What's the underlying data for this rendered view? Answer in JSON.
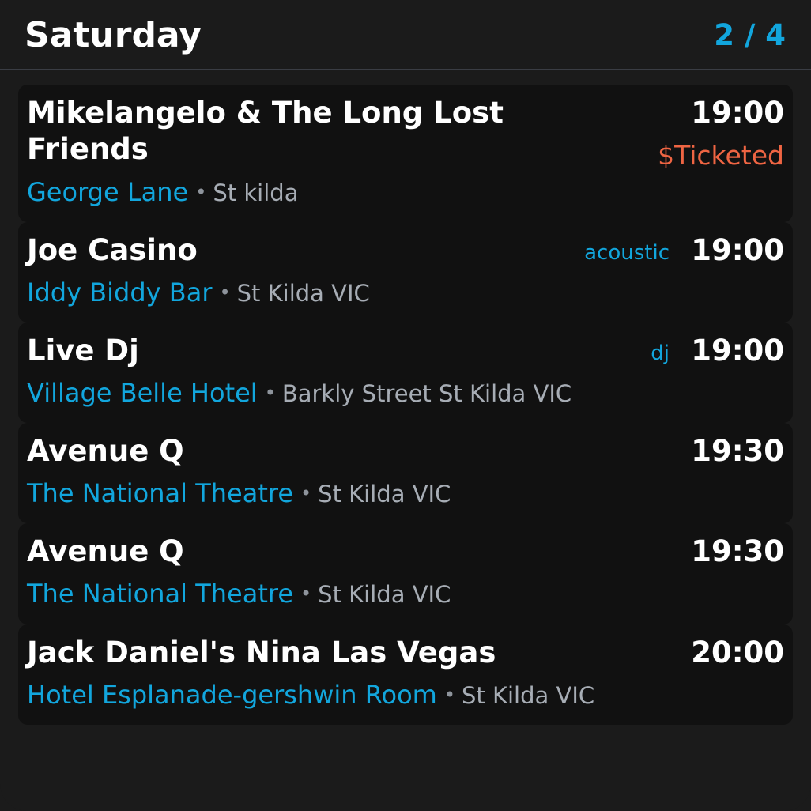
{
  "header": {
    "title": "Saturday",
    "page_counter": "2 / 4"
  },
  "events": [
    {
      "title": "Mikelangelo & The Long Lost Friends",
      "time": "19:00",
      "price": "$Ticketed",
      "genre": "",
      "venue": "George Lane",
      "separator": "•",
      "area": "St kilda"
    },
    {
      "title": "Joe Casino",
      "time": "19:00",
      "price": "",
      "genre": "acoustic",
      "venue": "Iddy Biddy Bar",
      "separator": "•",
      "area": "St Kilda VIC"
    },
    {
      "title": "Live Dj",
      "time": "19:00",
      "price": "",
      "genre": "dj",
      "venue": "Village Belle Hotel",
      "separator": "•",
      "area": "Barkly Street St Kilda VIC"
    },
    {
      "title": "Avenue Q",
      "time": "19:30",
      "price": "",
      "genre": "",
      "venue": "The National Theatre",
      "separator": "•",
      "area": "St Kilda VIC"
    },
    {
      "title": "Avenue Q",
      "time": "19:30",
      "price": "",
      "genre": "",
      "venue": "The National Theatre",
      "separator": "•",
      "area": "St Kilda VIC"
    },
    {
      "title": "Jack Daniel's Nina Las Vegas",
      "time": "20:00",
      "price": "",
      "genre": "",
      "venue": "Hotel Esplanade-gershwin Room",
      "separator": "•",
      "area": "St Kilda VIC"
    }
  ],
  "colors": {
    "background": "#1b1b1b",
    "card": "#111111",
    "accent": "#12a6dd",
    "price": "#ef6543",
    "muted": "#a7adb5"
  }
}
